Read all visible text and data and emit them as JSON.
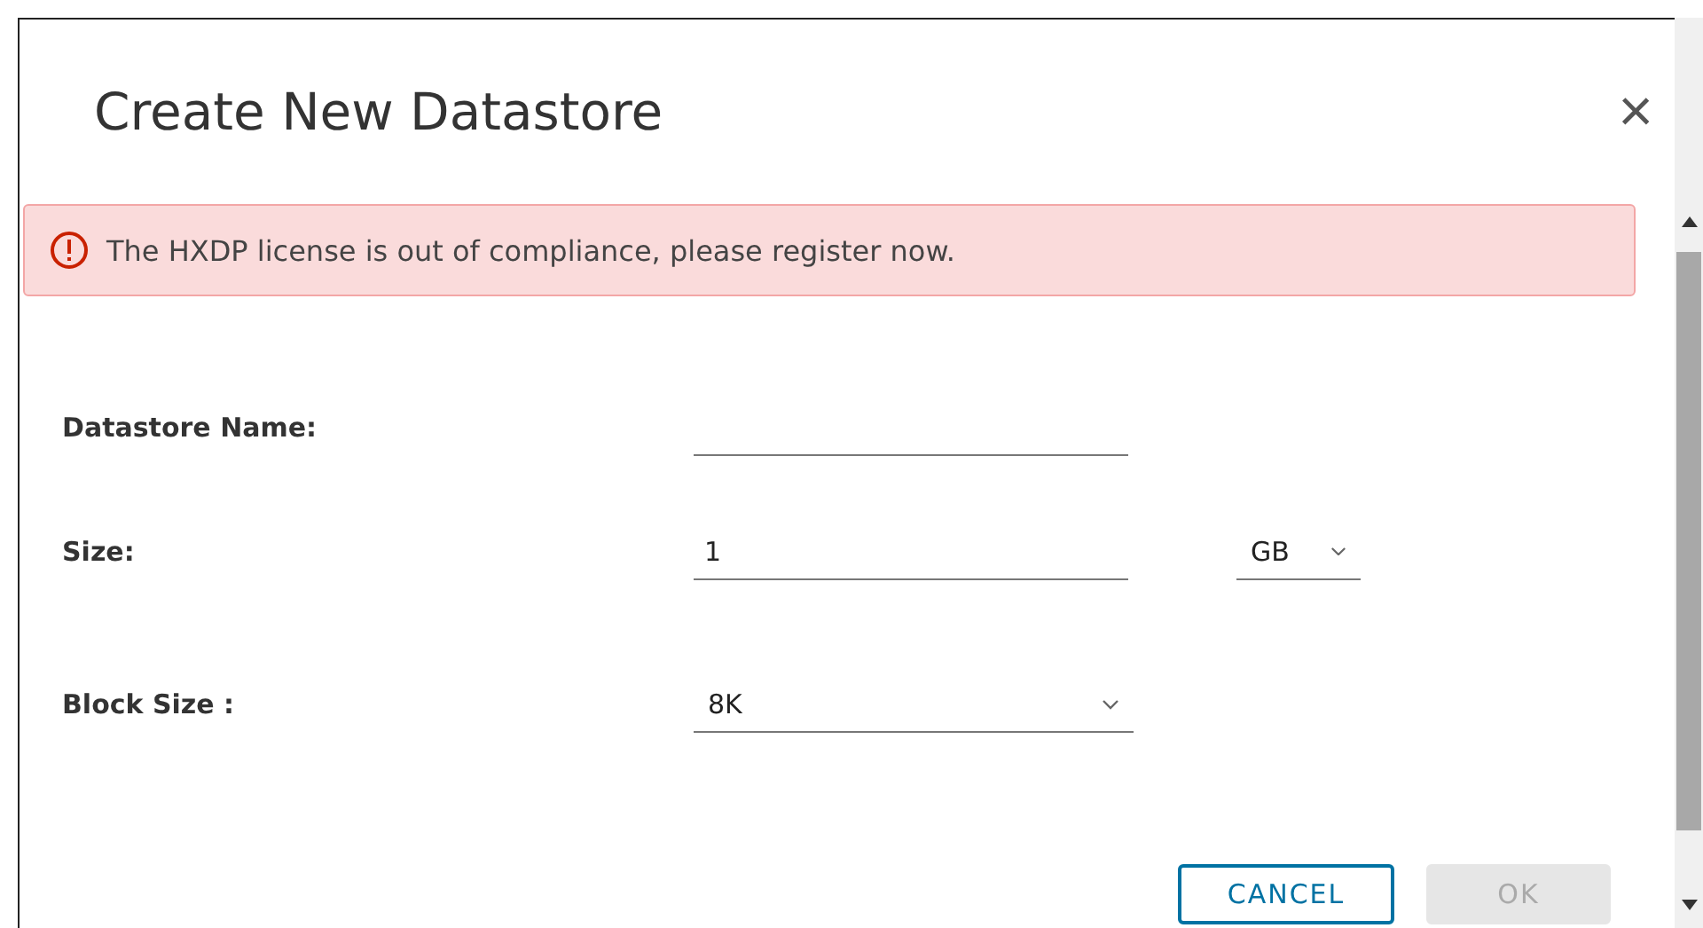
{
  "dialog": {
    "title": "Create New Datastore",
    "close": "×"
  },
  "alert": {
    "kind": "error",
    "message": "The HXDP license is out of compliance, please register now."
  },
  "fields": [
    {
      "kind": "text",
      "label": "Datastore Name:"
    },
    {
      "kind": "text-unit",
      "label": "Size:",
      "value": "1",
      "unit": "GB"
    },
    {
      "kind": "select",
      "label": "Block Size :",
      "value": "8K"
    }
  ],
  "buttons": [
    {
      "label": "CANCEL",
      "kind": "secondary",
      "disabled": false
    },
    {
      "label": "OK",
      "kind": "primary",
      "disabled": true
    }
  ]
}
